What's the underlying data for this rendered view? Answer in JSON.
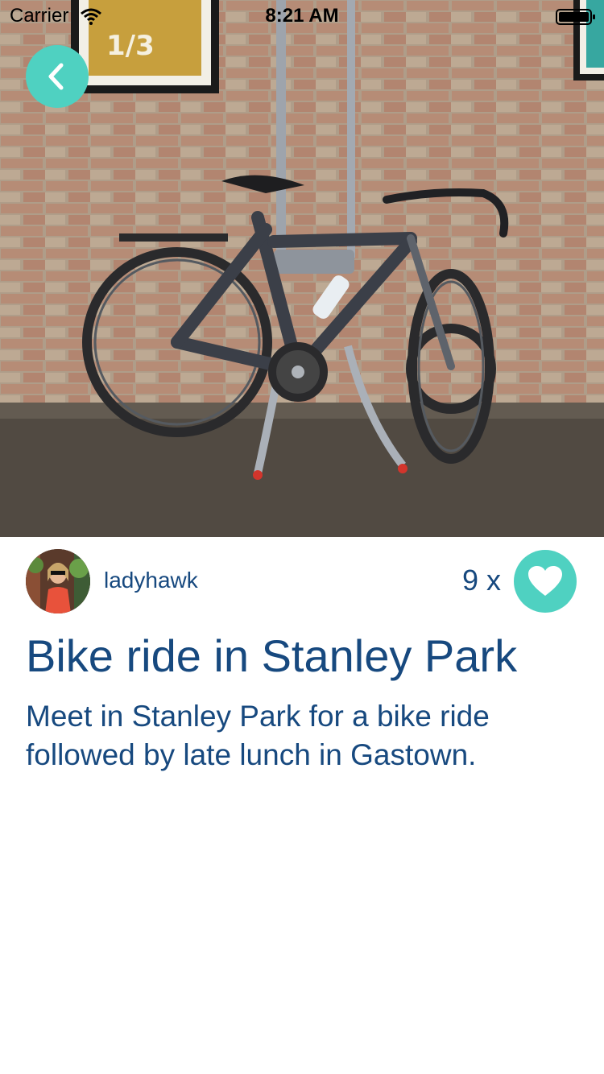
{
  "status_bar": {
    "carrier": "Carrier",
    "time": "8:21 AM"
  },
  "hero": {
    "image_subject": "bicycle-photo",
    "poster_text": "1/3"
  },
  "post": {
    "username": "ladyhawk",
    "like_count": "9 x",
    "title": "Bike ride in Stanley Park",
    "description": "Meet in Stanley Park for a bike ride followed by late lunch in Gastown."
  },
  "icons": {
    "back": "chevron-left-icon",
    "like": "heart-icon",
    "wifi": "wifi-icon",
    "battery": "battery-icon"
  },
  "colors": {
    "accent": "#4fd1c1",
    "text": "#17497f",
    "background": "#ffffff"
  }
}
